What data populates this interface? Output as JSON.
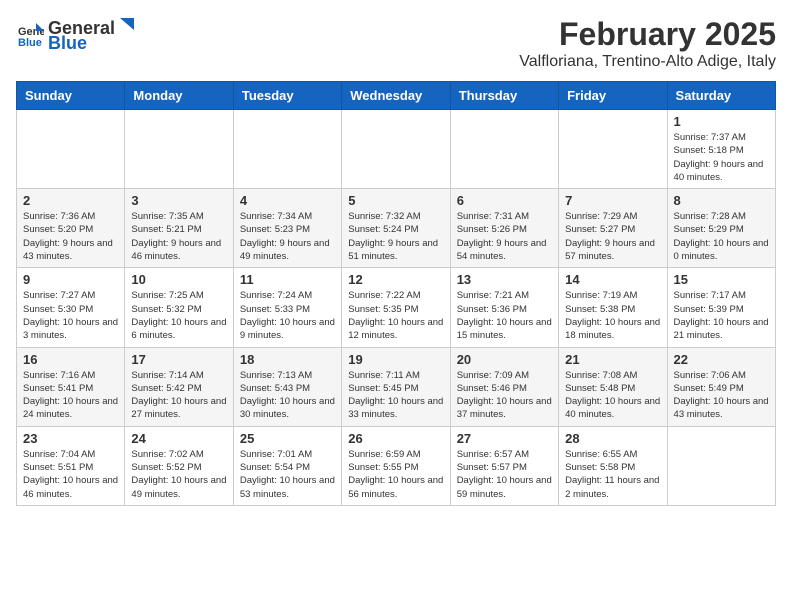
{
  "header": {
    "logo": {
      "general": "General",
      "blue": "Blue"
    },
    "title": "February 2025",
    "subtitle": "Valfloriana, Trentino-Alto Adige, Italy"
  },
  "days_of_week": [
    "Sunday",
    "Monday",
    "Tuesday",
    "Wednesday",
    "Thursday",
    "Friday",
    "Saturday"
  ],
  "weeks": [
    {
      "row_class": "normal-row",
      "days": [
        {
          "num": "",
          "info": ""
        },
        {
          "num": "",
          "info": ""
        },
        {
          "num": "",
          "info": ""
        },
        {
          "num": "",
          "info": ""
        },
        {
          "num": "",
          "info": ""
        },
        {
          "num": "",
          "info": ""
        },
        {
          "num": "1",
          "info": "Sunrise: 7:37 AM\nSunset: 5:18 PM\nDaylight: 9 hours and 40 minutes."
        }
      ]
    },
    {
      "row_class": "alt-row",
      "days": [
        {
          "num": "2",
          "info": "Sunrise: 7:36 AM\nSunset: 5:20 PM\nDaylight: 9 hours and 43 minutes."
        },
        {
          "num": "3",
          "info": "Sunrise: 7:35 AM\nSunset: 5:21 PM\nDaylight: 9 hours and 46 minutes."
        },
        {
          "num": "4",
          "info": "Sunrise: 7:34 AM\nSunset: 5:23 PM\nDaylight: 9 hours and 49 minutes."
        },
        {
          "num": "5",
          "info": "Sunrise: 7:32 AM\nSunset: 5:24 PM\nDaylight: 9 hours and 51 minutes."
        },
        {
          "num": "6",
          "info": "Sunrise: 7:31 AM\nSunset: 5:26 PM\nDaylight: 9 hours and 54 minutes."
        },
        {
          "num": "7",
          "info": "Sunrise: 7:29 AM\nSunset: 5:27 PM\nDaylight: 9 hours and 57 minutes."
        },
        {
          "num": "8",
          "info": "Sunrise: 7:28 AM\nSunset: 5:29 PM\nDaylight: 10 hours and 0 minutes."
        }
      ]
    },
    {
      "row_class": "normal-row",
      "days": [
        {
          "num": "9",
          "info": "Sunrise: 7:27 AM\nSunset: 5:30 PM\nDaylight: 10 hours and 3 minutes."
        },
        {
          "num": "10",
          "info": "Sunrise: 7:25 AM\nSunset: 5:32 PM\nDaylight: 10 hours and 6 minutes."
        },
        {
          "num": "11",
          "info": "Sunrise: 7:24 AM\nSunset: 5:33 PM\nDaylight: 10 hours and 9 minutes."
        },
        {
          "num": "12",
          "info": "Sunrise: 7:22 AM\nSunset: 5:35 PM\nDaylight: 10 hours and 12 minutes."
        },
        {
          "num": "13",
          "info": "Sunrise: 7:21 AM\nSunset: 5:36 PM\nDaylight: 10 hours and 15 minutes."
        },
        {
          "num": "14",
          "info": "Sunrise: 7:19 AM\nSunset: 5:38 PM\nDaylight: 10 hours and 18 minutes."
        },
        {
          "num": "15",
          "info": "Sunrise: 7:17 AM\nSunset: 5:39 PM\nDaylight: 10 hours and 21 minutes."
        }
      ]
    },
    {
      "row_class": "alt-row",
      "days": [
        {
          "num": "16",
          "info": "Sunrise: 7:16 AM\nSunset: 5:41 PM\nDaylight: 10 hours and 24 minutes."
        },
        {
          "num": "17",
          "info": "Sunrise: 7:14 AM\nSunset: 5:42 PM\nDaylight: 10 hours and 27 minutes."
        },
        {
          "num": "18",
          "info": "Sunrise: 7:13 AM\nSunset: 5:43 PM\nDaylight: 10 hours and 30 minutes."
        },
        {
          "num": "19",
          "info": "Sunrise: 7:11 AM\nSunset: 5:45 PM\nDaylight: 10 hours and 33 minutes."
        },
        {
          "num": "20",
          "info": "Sunrise: 7:09 AM\nSunset: 5:46 PM\nDaylight: 10 hours and 37 minutes."
        },
        {
          "num": "21",
          "info": "Sunrise: 7:08 AM\nSunset: 5:48 PM\nDaylight: 10 hours and 40 minutes."
        },
        {
          "num": "22",
          "info": "Sunrise: 7:06 AM\nSunset: 5:49 PM\nDaylight: 10 hours and 43 minutes."
        }
      ]
    },
    {
      "row_class": "normal-row",
      "days": [
        {
          "num": "23",
          "info": "Sunrise: 7:04 AM\nSunset: 5:51 PM\nDaylight: 10 hours and 46 minutes."
        },
        {
          "num": "24",
          "info": "Sunrise: 7:02 AM\nSunset: 5:52 PM\nDaylight: 10 hours and 49 minutes."
        },
        {
          "num": "25",
          "info": "Sunrise: 7:01 AM\nSunset: 5:54 PM\nDaylight: 10 hours and 53 minutes."
        },
        {
          "num": "26",
          "info": "Sunrise: 6:59 AM\nSunset: 5:55 PM\nDaylight: 10 hours and 56 minutes."
        },
        {
          "num": "27",
          "info": "Sunrise: 6:57 AM\nSunset: 5:57 PM\nDaylight: 10 hours and 59 minutes."
        },
        {
          "num": "28",
          "info": "Sunrise: 6:55 AM\nSunset: 5:58 PM\nDaylight: 11 hours and 2 minutes."
        },
        {
          "num": "",
          "info": ""
        }
      ]
    }
  ]
}
